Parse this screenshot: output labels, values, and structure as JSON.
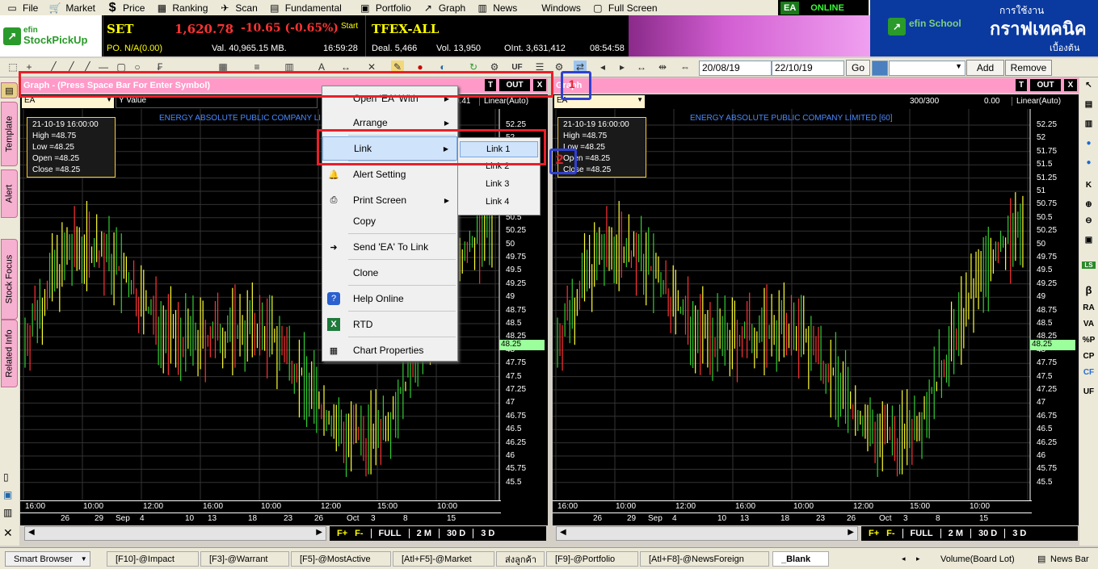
{
  "menu": [
    {
      "label": "File",
      "icon": "file-icon"
    },
    {
      "label": "Market",
      "icon": "market-icon"
    },
    {
      "label": "Price",
      "icon": "dollar-icon"
    },
    {
      "label": "Ranking",
      "icon": "ranking-icon"
    },
    {
      "label": "Scan",
      "icon": "scan-icon"
    },
    {
      "label": "Fundamental",
      "icon": "fundamental-icon"
    },
    {
      "label": "Portfolio",
      "icon": "portfolio-icon"
    },
    {
      "label": "Graph",
      "icon": "graph-icon"
    },
    {
      "label": "News",
      "icon": "news-icon"
    },
    {
      "label": "Windows",
      "icon": ""
    },
    {
      "label": "Full Screen",
      "icon": "fullscreen-icon"
    }
  ],
  "status": {
    "symbol": "EA",
    "online": "ONLINE"
  },
  "logo": {
    "line1": "efin",
    "line2": "StockPickUp"
  },
  "ticker": {
    "set_label": "SET",
    "set_value": "1,620.78",
    "set_change": "-10.65 (-0.65%)",
    "po": "PO. N/A(0.00)",
    "val": "Val. 40,965.15 MB.",
    "time": "16:59:28",
    "start": "Start",
    "tfex_label": "TFEX-ALL",
    "deal": "Deal. 5,466",
    "vol": "Vol. 13,950",
    "oint": "OInt. 3,631,412",
    "tfex_time": "08:54:58"
  },
  "banner": {
    "title": "efin School",
    "thai1": "การใช้งาน",
    "thai2": "กราฟเทคนิค",
    "thai3": "เบื้องต้น"
  },
  "toolbar": {
    "date_from": "20/08/19",
    "date_to": "22/10/19",
    "go": "Go",
    "add": "Add",
    "remove": "Remove"
  },
  "left_tabs": [
    "Template",
    "Alert",
    "Stock Focus",
    "Related Info"
  ],
  "left_pane": {
    "title": "Graph  - (Press Space Bar For Enter Symbol)",
    "btn_t": "T",
    "btn_out": "OUT",
    "btn_x": "X",
    "symbol": "EA",
    "yvalue": "Y Value",
    "scale_val": "9.41",
    "scale": "Linear(Auto)",
    "chart_title": "ENERGY ABSOLUTE PUBLIC COMPANY LI",
    "info": [
      "21-10-19 16:00:00",
      "High  =48.75",
      "Low   =48.25",
      "Open  =48.25",
      "Close  =48.25"
    ],
    "price_tag": "48.25"
  },
  "right_pane": {
    "title": "Graph",
    "btn_t": "T",
    "btn_out": "OUT",
    "btn_x": "X",
    "symbol": "EA",
    "count": "300/300",
    "value": "0.00",
    "scale": "Linear(Auto)",
    "chart_title": "ENERGY ABSOLUTE PUBLIC COMPANY LIMITED [60]",
    "info": [
      "21-10-19 16:00:00",
      "High  =48.75",
      "Low   =48.25",
      "Open  =48.25",
      "Close  =48.25"
    ],
    "price_tag": "48.25"
  },
  "y_ticks": [
    "52.25",
    "52",
    "51.75",
    "51.5",
    "51.25",
    "51",
    "50.75",
    "50.5",
    "50.25",
    "50",
    "49.75",
    "49.5",
    "49.25",
    "49",
    "48.75",
    "48.5",
    "48.25",
    "48",
    "47.75",
    "47.5",
    "47.25",
    "47",
    "46.75",
    "46.5",
    "46.25",
    "46",
    "45.75",
    "45.5"
  ],
  "x_times": [
    "16:00",
    "10:00",
    "12:00",
    "16:00",
    "10:00",
    "12:00",
    "15:00",
    "10:00"
  ],
  "x_dates": [
    "26",
    "29",
    "Sep",
    "4",
    "10",
    "13",
    "18",
    "23",
    "26",
    "Oct",
    "3",
    "8",
    "15"
  ],
  "zoom": {
    "fplus": "F+",
    "fminus": "F-",
    "full": "FULL",
    "m2": "2 M",
    "d30": "30 D",
    "d3": "3 D"
  },
  "context_menu": [
    {
      "label": "Open 'EA' With",
      "arrow": true,
      "icon": ""
    },
    {
      "label": "Arrange",
      "arrow": true,
      "icon": ""
    },
    {
      "label": "Link",
      "arrow": true,
      "icon": ""
    },
    {
      "label": "Alert Setting",
      "arrow": false,
      "icon": "alert-icon"
    },
    {
      "label": "Print Screen",
      "arrow": true,
      "icon": "printer-icon"
    },
    {
      "label": "Copy",
      "arrow": false,
      "icon": ""
    },
    {
      "label": "Send 'EA' To Link",
      "arrow": false,
      "icon": "send-icon"
    },
    {
      "label": "Clone",
      "arrow": false,
      "icon": ""
    },
    {
      "label": "Help Online",
      "arrow": false,
      "icon": "help-icon"
    },
    {
      "label": "RTD",
      "arrow": false,
      "icon": "excel-icon"
    },
    {
      "label": "Chart Properties",
      "arrow": false,
      "icon": "properties-icon"
    }
  ],
  "submenu": [
    "Link 1",
    "Link 2",
    "Link 3",
    "Link 4"
  ],
  "annotations": {
    "num1": "1",
    "num2": "2"
  },
  "right_tools": [
    "β",
    "RA",
    "VA",
    "%P",
    "CP",
    "CF",
    "UF"
  ],
  "bottom": {
    "smart_browser": "Smart Browser",
    "tabs": [
      "[F10]-@Impact",
      "[F3]-@Warrant",
      "[F5]-@MostActive",
      "[Atl+F5]-@Market",
      "ส่งลูกค้า",
      "[F9]-@Portfolio",
      "[Atl+F8]-@NewsForeign",
      "_Blank"
    ],
    "volume": "Volume(Board Lot)",
    "newsbar": "News Bar"
  },
  "colors": {
    "pink": "#ff9ac8",
    "red_box": "#e8202a",
    "blue_box": "#3040d0",
    "chart_bg": "#000000"
  }
}
